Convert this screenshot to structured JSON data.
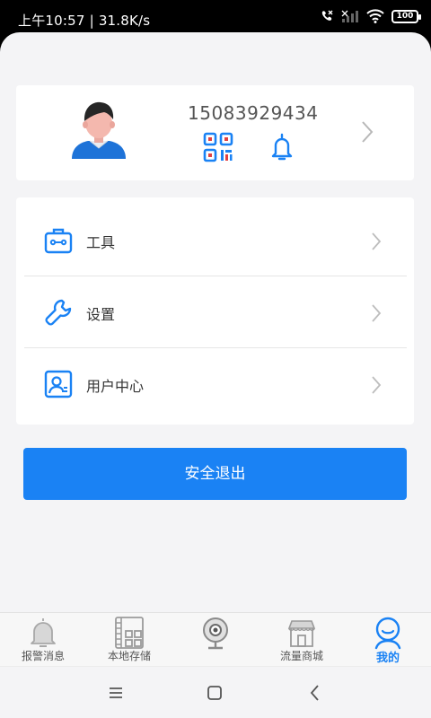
{
  "status_bar": {
    "time": "上午10:57 | 31.8K/s",
    "battery": "100"
  },
  "profile": {
    "phone": "15083929434",
    "icons": [
      "avatar-icon",
      "qr-code-icon",
      "bell-icon",
      "chevron-right-icon"
    ]
  },
  "menu": {
    "items": [
      {
        "label": "工具",
        "icon": "toolbox-icon"
      },
      {
        "label": "设置",
        "icon": "wrench-icon"
      },
      {
        "label": "用户中心",
        "icon": "user-card-icon"
      }
    ]
  },
  "logout": {
    "label": "安全退出"
  },
  "tabbar": {
    "tabs": [
      {
        "label": "报警消息",
        "icon": "alarm-bell-icon",
        "active": false
      },
      {
        "label": "本地存储",
        "icon": "film-grid-icon",
        "active": false
      },
      {
        "label": "",
        "icon": "webcam-icon",
        "active": false
      },
      {
        "label": "流量商城",
        "icon": "store-icon",
        "active": false
      },
      {
        "label": "我的",
        "icon": "profile-face-icon",
        "active": true
      }
    ]
  },
  "colors": {
    "accent": "#1a82f4",
    "background": "#f4f4f6",
    "card": "#ffffff"
  }
}
